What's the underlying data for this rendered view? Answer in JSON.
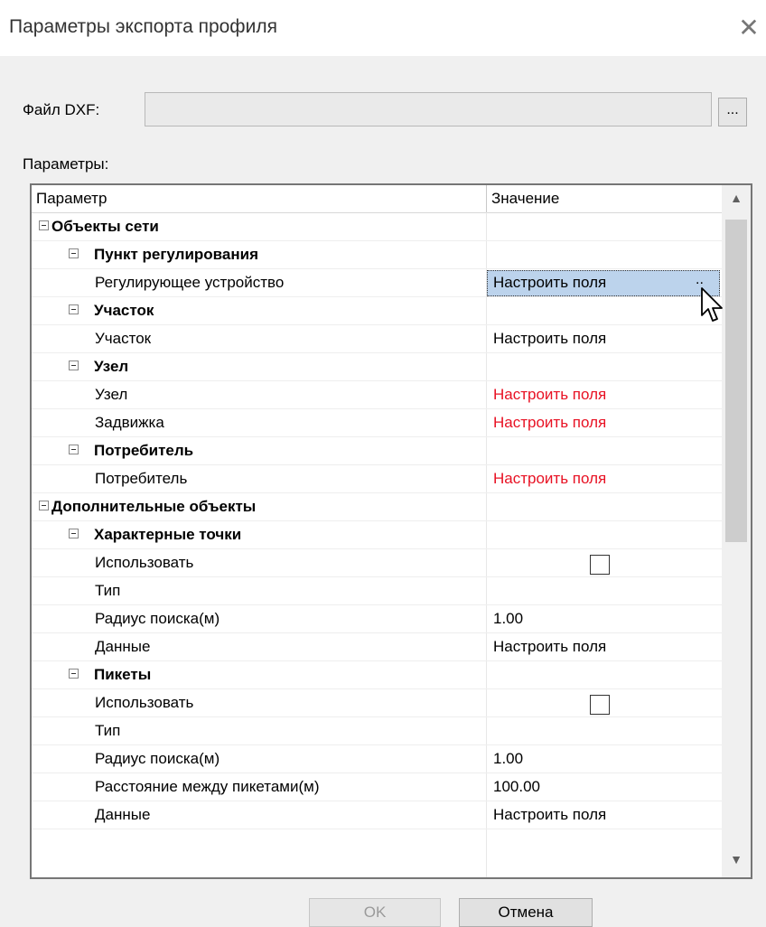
{
  "window": {
    "title": "Параметры экспорта профиля"
  },
  "file": {
    "label": "Файл DXF:",
    "value": "",
    "browse_label": "..."
  },
  "params_label": "Параметры:",
  "grid": {
    "columns": [
      "Параметр",
      "Значение"
    ],
    "rows": [
      {
        "name": "Объекты сети",
        "value": "",
        "level": 0,
        "group": true
      },
      {
        "name": "Пункт регулирования",
        "value": "",
        "level": 1,
        "group": true
      },
      {
        "name": "Регулирующее устройство",
        "value": "Настроить поля",
        "level": 2,
        "selected": true
      },
      {
        "name": "Участок",
        "value": "",
        "level": 1,
        "group": true
      },
      {
        "name": "Участок",
        "value": "Настроить поля",
        "level": 2
      },
      {
        "name": "Узел",
        "value": "",
        "level": 1,
        "group": true
      },
      {
        "name": "Узел",
        "value": "Настроить поля",
        "level": 2,
        "red": true
      },
      {
        "name": "Задвижка",
        "value": "Настроить поля",
        "level": 2,
        "red": true
      },
      {
        "name": "Потребитель",
        "value": "",
        "level": 1,
        "group": true
      },
      {
        "name": "Потребитель",
        "value": "Настроить поля",
        "level": 2,
        "red": true
      },
      {
        "name": "Дополнительные объекты",
        "value": "",
        "level": 0,
        "group": true
      },
      {
        "name": "Характерные точки",
        "value": "",
        "level": 1,
        "group": true
      },
      {
        "name": "Использовать",
        "value": "",
        "level": 2,
        "checkbox": true
      },
      {
        "name": "Тип",
        "value": "",
        "level": 2
      },
      {
        "name": "Радиус поиска(м)",
        "value": "1.00",
        "level": 2
      },
      {
        "name": "Данные",
        "value": "Настроить поля",
        "level": 2
      },
      {
        "name": "Пикеты",
        "value": "",
        "level": 1,
        "group": true
      },
      {
        "name": "Использовать",
        "value": "",
        "level": 2,
        "checkbox": true
      },
      {
        "name": "Тип",
        "value": "",
        "level": 2
      },
      {
        "name": "Радиус поиска(м)",
        "value": "1.00",
        "level": 2
      },
      {
        "name": "Расстояние между пикетами(м)",
        "value": "100.00",
        "level": 2
      },
      {
        "name": "Данные",
        "value": "Настроить поля",
        "level": 2
      }
    ]
  },
  "buttons": {
    "ok": "OK",
    "cancel": "Отмена"
  },
  "colors": {
    "warning_text": "#e81123",
    "selection": "#bcd3ec"
  }
}
